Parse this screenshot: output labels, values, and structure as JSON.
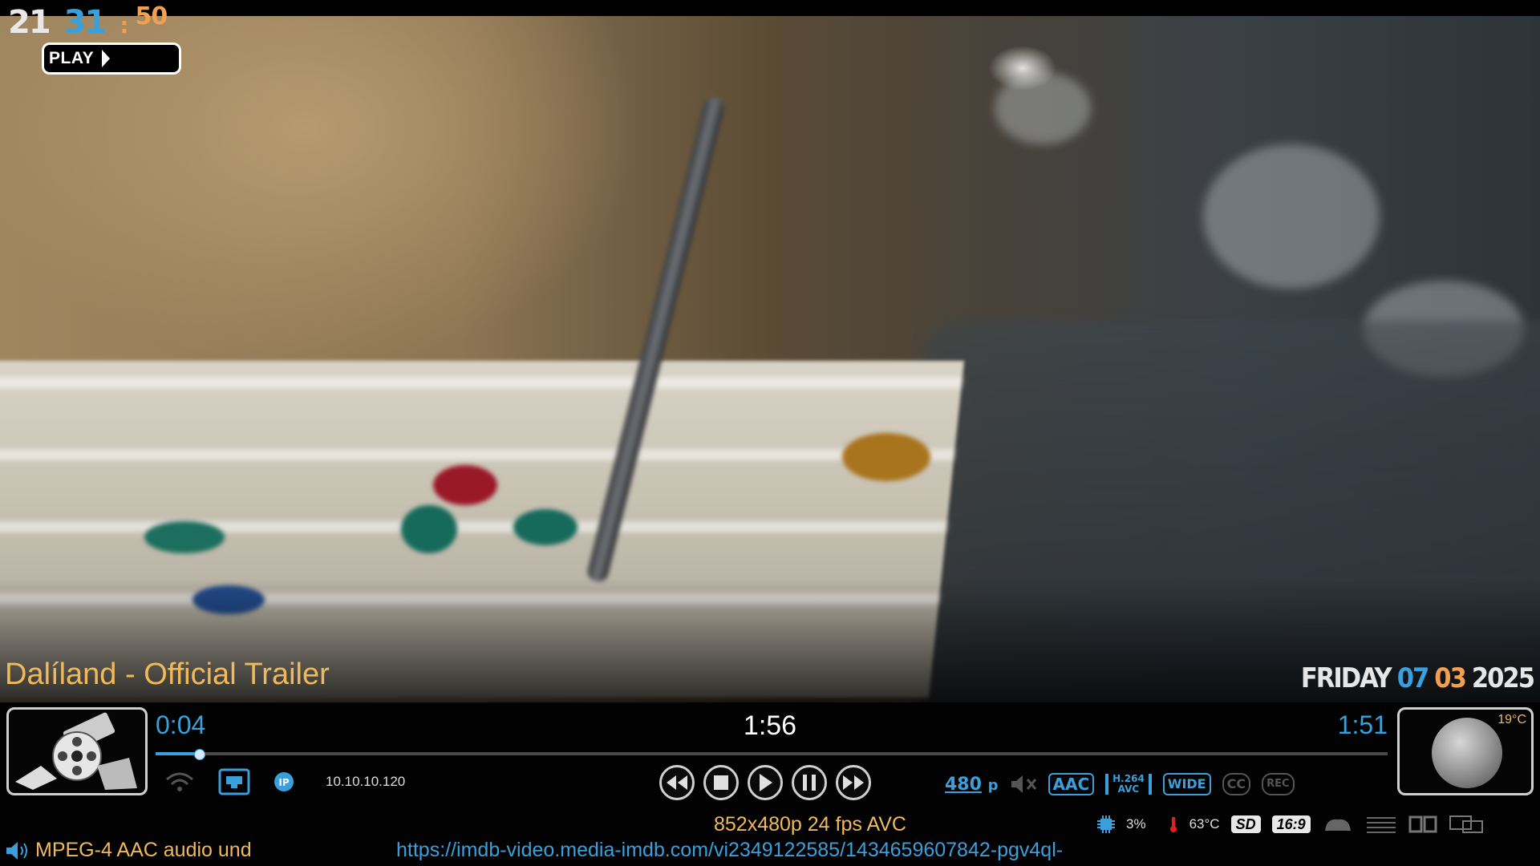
{
  "clock": {
    "hour": "21",
    "minute": "31",
    "colon": ":",
    "second": "50"
  },
  "status": {
    "label": "PLAY"
  },
  "media": {
    "title": "Dalíland - Official Trailer"
  },
  "date": {
    "weekday": "FRIDAY",
    "day": "07",
    "month": "03",
    "year": "2025"
  },
  "time": {
    "elapsed": "0:04",
    "total": "1:56",
    "remaining": "1:51",
    "progress_fraction": 0.035
  },
  "network": {
    "ip": "10.10.10.120"
  },
  "controls": [
    "rewind-icon",
    "stop-icon",
    "play-icon",
    "pause-icon",
    "fast-forward-icon"
  ],
  "badges": {
    "resolution": "480",
    "resolution_suffix": "p",
    "audio_codec": "AAC",
    "video_codec_top": "H.264",
    "video_codec_bottom": "AVC",
    "aspect": "WIDE",
    "cc": "CC",
    "rec": "REC"
  },
  "system": {
    "cpu": "3%",
    "cpu_temp": "63°C",
    "definition": "SD",
    "ratio": "16:9"
  },
  "weather": {
    "temp": "19°C"
  },
  "video_info": "852x480p  24 fps  AVC",
  "audio_info": "MPEG-4 AAC audio und",
  "url": "https://imdb-video.media-imdb.com/vi2349122585/1434659607842-pgv4ql-",
  "colors": {
    "accent_blue": "#3aa0dc",
    "accent_gold": "#f0b95a",
    "accent_orange": "#f0a050"
  }
}
